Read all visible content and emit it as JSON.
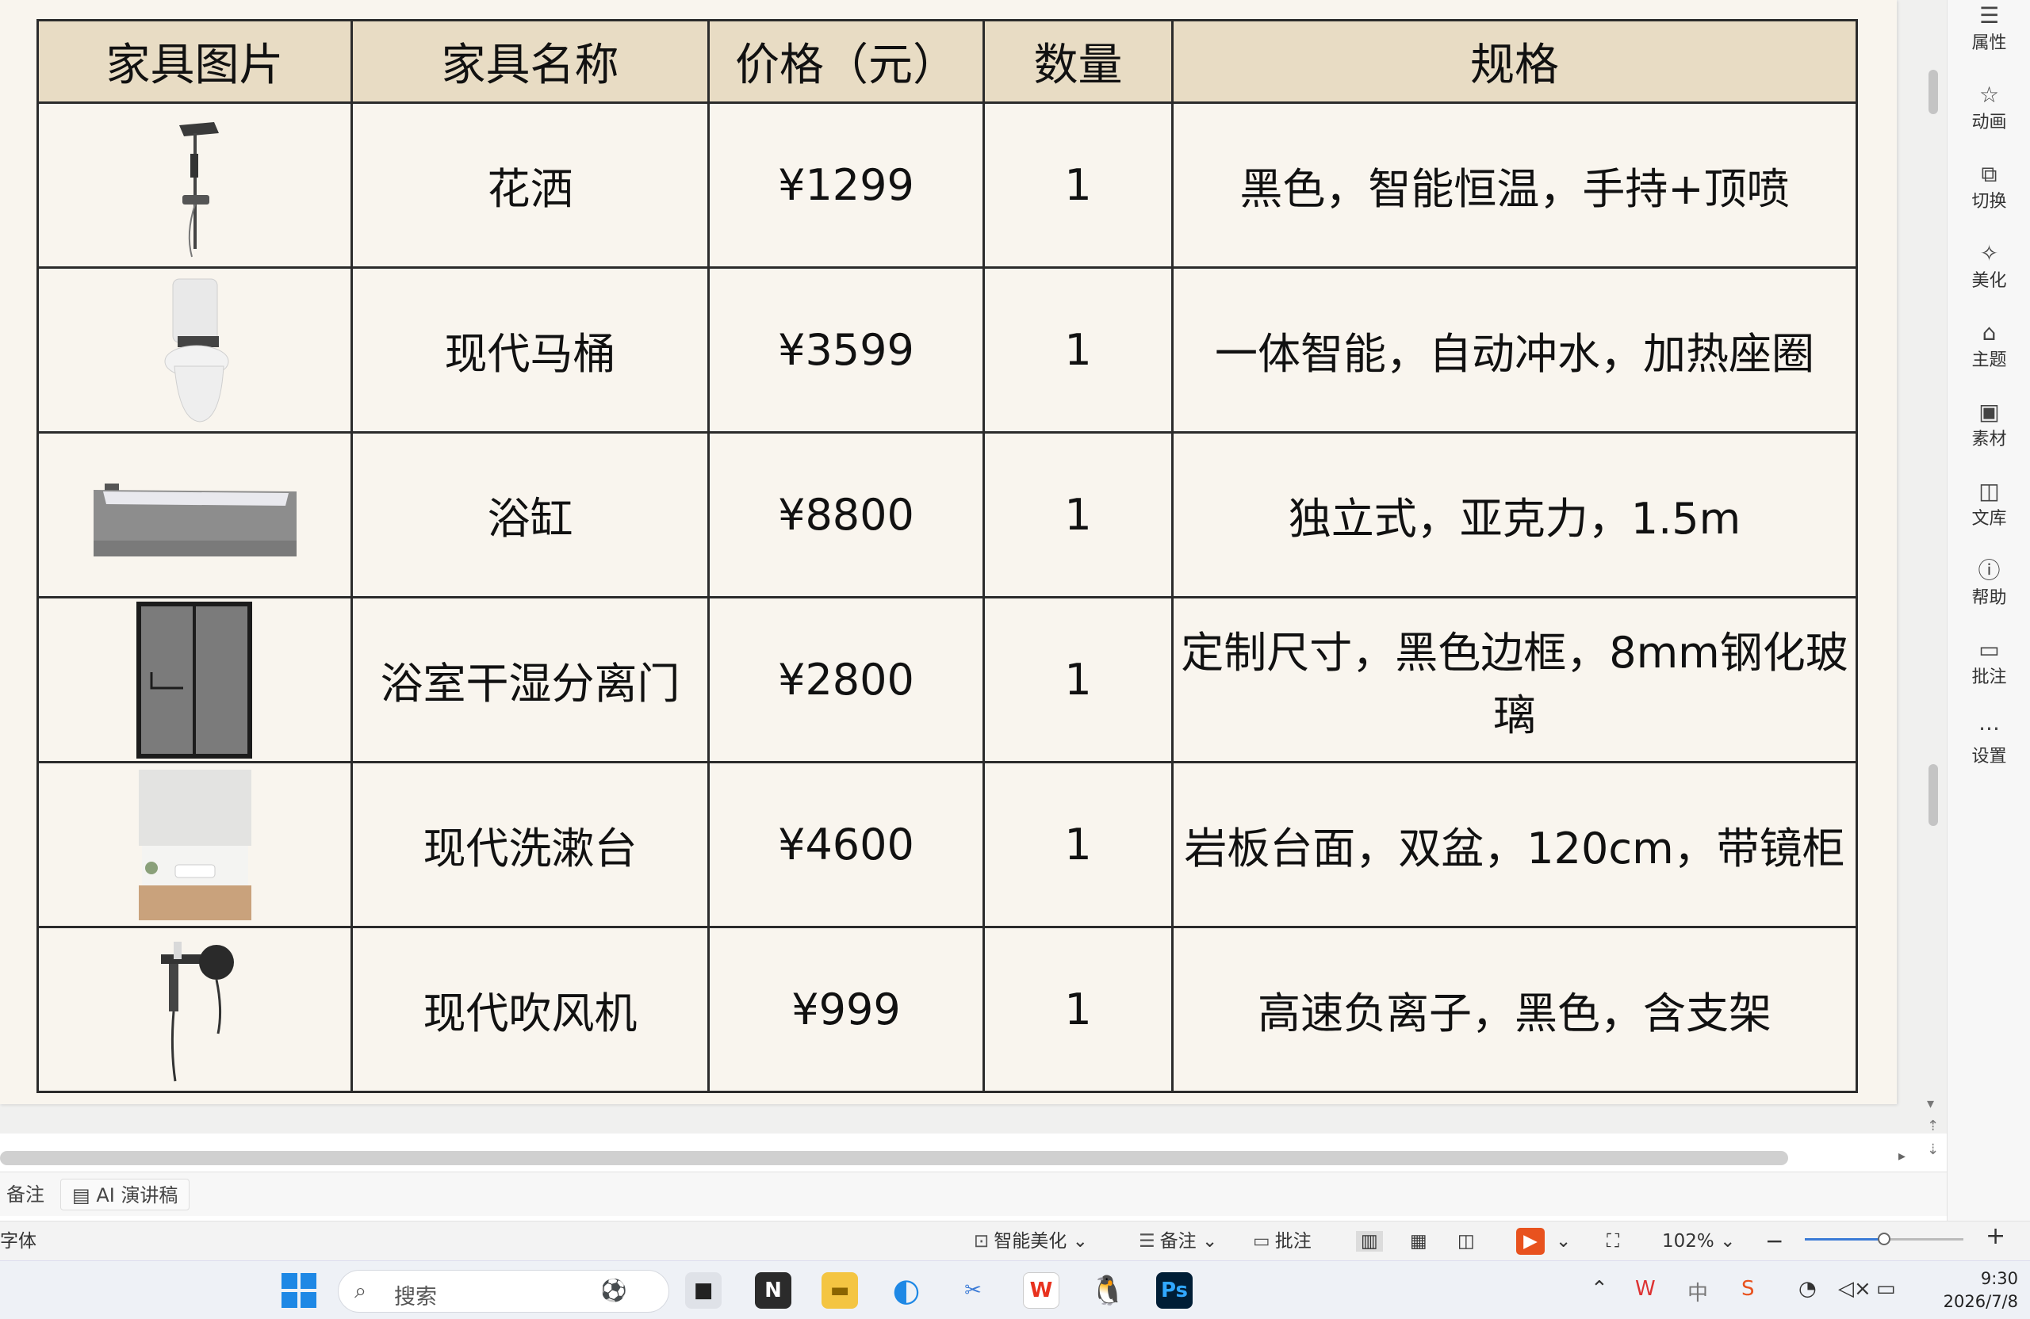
{
  "table": {
    "headers": [
      "家具图片",
      "家具名称",
      "价格（元）",
      "数量",
      "规格"
    ],
    "rows": [
      {
        "image_icon": "shower-image",
        "name": "花洒",
        "price": "¥1299",
        "qty": "1",
        "spec": "黑色，智能恒温，手持+顶喷"
      },
      {
        "image_icon": "toilet-image",
        "name": "现代马桶",
        "price": "¥3599",
        "qty": "1",
        "spec": "一体智能，自动冲水，加热座圈"
      },
      {
        "image_icon": "bathtub-image",
        "name": "浴缸",
        "price": "¥8800",
        "qty": "1",
        "spec": "独立式，亚克力，1.5m"
      },
      {
        "image_icon": "shower-door-image",
        "name": "浴室干湿分离门",
        "price": "¥2800",
        "qty": "1",
        "spec": "定制尺寸，黑色边框，8mm钢化玻璃"
      },
      {
        "image_icon": "vanity-image",
        "name": "现代洗漱台",
        "price": "¥4600",
        "qty": "1",
        "spec": "岩板台面，双盆，120cm，带镜柜"
      },
      {
        "image_icon": "hair-dryer-image",
        "name": "现代吹风机",
        "price": "¥999",
        "qty": "1",
        "spec": "高速负离子，黑色，含支架"
      }
    ]
  },
  "right_panel": {
    "items": [
      {
        "label": "属性",
        "icon": "properties-icon"
      },
      {
        "label": "动画",
        "icon": "animation-icon"
      },
      {
        "label": "切换",
        "icon": "transition-icon"
      },
      {
        "label": "美化",
        "icon": "beautify-icon"
      },
      {
        "label": "主题",
        "icon": "theme-icon"
      },
      {
        "label": "素材",
        "icon": "material-icon"
      },
      {
        "label": "文库",
        "icon": "library-icon"
      },
      {
        "label": "帮助",
        "icon": "help-icon"
      },
      {
        "label": "批注",
        "icon": "comment-icon"
      },
      {
        "label": "设置",
        "icon": "more-icon"
      }
    ]
  },
  "notes_bar": {
    "notes_label": "备注",
    "speech_label": "AI 演讲稿"
  },
  "status_bar": {
    "left_text": "字体",
    "smart_beautify": "智能美化",
    "notes": "备注",
    "comments": "批注",
    "zoom": "102%",
    "zoom_level_percent": 50
  },
  "taskbar": {
    "search_placeholder": "搜索",
    "time": "9:30",
    "date": "2026/7/8"
  },
  "colors": {
    "header_bg": "#e8dcc4",
    "slide_bg": "#f9f5ee",
    "accent": "#3b7bd6",
    "wps_red": "#e8321e"
  }
}
